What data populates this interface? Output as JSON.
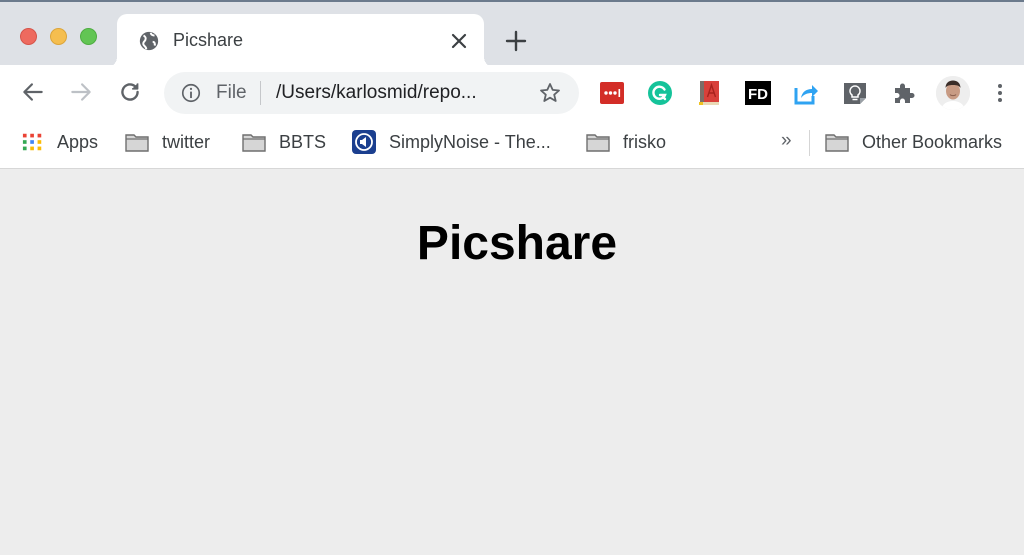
{
  "window": {
    "controls": [
      "close",
      "minimize",
      "zoom"
    ]
  },
  "tabs": [
    {
      "title": "Picshare",
      "icon": "globe-icon",
      "active": true
    }
  ],
  "toolbar": {
    "omnibox": {
      "security_label": "File",
      "url": "/Users/karlosmid/repo..."
    },
    "extensions": [
      {
        "name": "lastpass-icon",
        "color": "#d32d27"
      },
      {
        "name": "grammarly-icon",
        "color": "#15c39a"
      },
      {
        "name": "dictionary-icon",
        "color": "#c9453f"
      },
      {
        "name": "fd-icon",
        "color": "#000000"
      },
      {
        "name": "share-icon",
        "color": "#2fa3f2"
      },
      {
        "name": "lightbulb-icon",
        "color": "#5f6368"
      },
      {
        "name": "puzzle-icon",
        "color": "#5f6368"
      }
    ]
  },
  "bookmarks": {
    "items": [
      {
        "label": "Apps",
        "icon": "apps-grid-icon"
      },
      {
        "label": "twitter",
        "icon": "folder-icon"
      },
      {
        "label": "BBTS",
        "icon": "folder-icon"
      },
      {
        "label": "SimplyNoise - The...",
        "icon": "simplynoise-icon"
      },
      {
        "label": "frisko",
        "icon": "folder-icon"
      }
    ],
    "overflow": "»",
    "other": {
      "label": "Other Bookmarks",
      "icon": "folder-icon"
    }
  },
  "page": {
    "heading": "Picshare"
  }
}
